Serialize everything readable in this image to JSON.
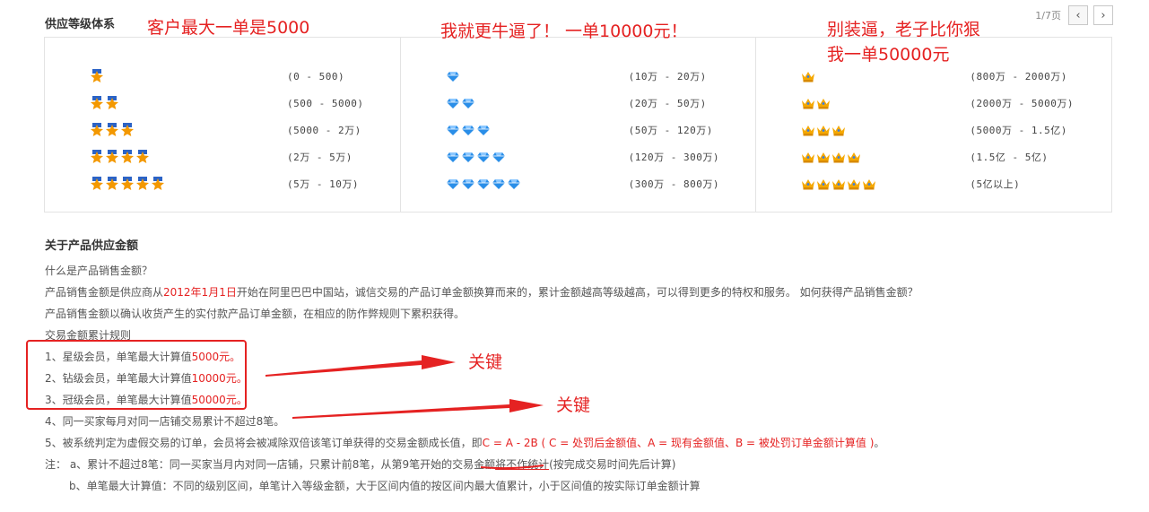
{
  "header": {
    "title": "供应等级体系",
    "pager_text": "1/7页",
    "prev_icon": "‹",
    "next_icon": "›"
  },
  "annotations": {
    "a1": "客户最大一单是5000",
    "a2": "我就更牛逼了！ 一单10000元！",
    "a3_line1": "别装逼，老子比你狠",
    "a3_line2": "我一单50000元",
    "key1": "关键",
    "key2": "关键"
  },
  "grades": {
    "stars": {
      "icon": "star-icon",
      "color": "#f39800",
      "rows": [
        {
          "count": 1,
          "range": "(0 - 500)"
        },
        {
          "count": 2,
          "range": "(500 - 5000)"
        },
        {
          "count": 3,
          "range": "(5000 - 2万)"
        },
        {
          "count": 4,
          "range": "(2万 - 5万)"
        },
        {
          "count": 5,
          "range": "(5万 - 10万)"
        }
      ]
    },
    "diamonds": {
      "icon": "diamond-icon",
      "color": "#2a8ee8",
      "rows": [
        {
          "count": 1,
          "range": "(10万 - 20万)"
        },
        {
          "count": 2,
          "range": "(20万 - 50万)"
        },
        {
          "count": 3,
          "range": "(50万 - 120万)"
        },
        {
          "count": 4,
          "range": "(120万 - 300万)"
        },
        {
          "count": 5,
          "range": "(300万 - 800万)"
        }
      ]
    },
    "crowns": {
      "icon": "crown-icon",
      "color": "#f5a800",
      "rows": [
        {
          "count": 1,
          "range": "(800万 - 2000万)"
        },
        {
          "count": 2,
          "range": "(2000万 - 5000万)"
        },
        {
          "count": 3,
          "range": "(5000万 - 1.5亿)"
        },
        {
          "count": 4,
          "range": "(1.5亿 - 5亿)"
        },
        {
          "count": 5,
          "range": "(5亿以上)"
        }
      ]
    }
  },
  "about": {
    "title": "关于产品供应金额",
    "q1": "什么是产品销售金额？",
    "p1_a": "产品销售金额是供应商从",
    "p1_date": "2012年1月1日",
    "p1_b": "开始在阿里巴巴中国站，诚信交易的产品订单金额换算而来的，累计金额越高等级越高，可以得到更多的特权和服务。 如何获得产品销售金额？",
    "p2": "产品销售金额以确认收货产生的实付款产品订单金额，在相应的防作弊规则下累积获得。",
    "rules_title": "交易金额累计规则",
    "r1_a": "1、星级会员，单笔最大计算值",
    "r1_b": "5000元。",
    "r2_a": "2、钻级会员，单笔最大计算值",
    "r2_b": "10000元。",
    "r3_a": "3、冠级会员，单笔最大计算值",
    "r3_b": "50000元。",
    "r4": "4、同一买家每月对同一店铺交易累计不超过8笔。",
    "r5_a": "5、被系统判定为虚假交易的订单，会员将会被减除双倍该笔订单获得的交易金额成长值，即",
    "r5_b": "C = A - 2B ( C = 处罚后金额值、A = 现有金额值、B = 被处罚订单金额计算值 )",
    "r5_c": "。",
    "note_a1": "注： a、累计不超过8笔：同一买家当月内对同一店铺，只累计前8笔，从第9笔开始的交易金额",
    "note_a2": "将不作统计",
    "note_a3": "(按完成交易时间先后计算)",
    "note_b": "b、单笔最大计算值：不同的级别区间，单笔计入等级金额，大于区间内值的按区间内最大值累计，小于区间值的按实际订单金额计算"
  }
}
